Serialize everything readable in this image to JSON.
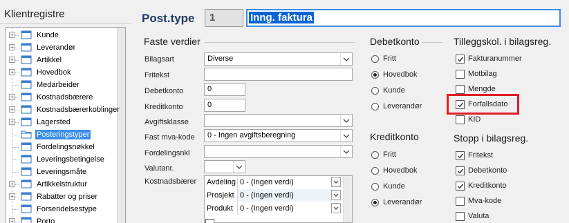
{
  "tree": {
    "title": "Klientregistre",
    "items": [
      {
        "label": "Kunde",
        "expandable": true
      },
      {
        "label": "Leverandør",
        "expandable": true
      },
      {
        "label": "Artikkel",
        "expandable": true
      },
      {
        "label": "Hovedbok",
        "expandable": true
      },
      {
        "label": "Medarbeider",
        "expandable": false
      },
      {
        "label": "Kostnadsbærere",
        "expandable": true
      },
      {
        "label": "Kostnadsbærerkoblinger",
        "expandable": true
      },
      {
        "label": "Lagersted",
        "expandable": true
      },
      {
        "label": "Posteringstyper",
        "expandable": false,
        "selected": true
      },
      {
        "label": "Fordelingsnøkkel",
        "expandable": false
      },
      {
        "label": "Leveringsbetingelse",
        "expandable": false
      },
      {
        "label": "Leveringsmåte",
        "expandable": false
      },
      {
        "label": "Artikkelstruktur",
        "expandable": true
      },
      {
        "label": "Rabatter og priser",
        "expandable": true
      },
      {
        "label": "Forsendelsestype",
        "expandable": false
      },
      {
        "label": "Porto",
        "expandable": true
      }
    ]
  },
  "header": {
    "title": "Post.type",
    "number": "1",
    "name": "Inng. faktura"
  },
  "faste": {
    "heading": "Faste verdier",
    "bilagsart_label": "Bilagsart",
    "bilagsart_value": "Diverse",
    "fritekst_label": "Fritekst",
    "fritekst_value": "",
    "debetkonto_label": "Debetkonto",
    "debetkonto_value": "0",
    "kreditkonto_label": "Kreditkonto",
    "kreditkonto_value": "0",
    "avgiftsklasse_label": "Avgiftsklasse",
    "avgiftsklasse_value": "",
    "fastmva_label": "Fast mva-kode",
    "fastmva_value": "0 - Ingen avgiftsberegning",
    "fordelingsnkl_label": "Fordelingsnkl",
    "fordelingsnkl_value": "",
    "valutanr_label": "Valutanr.",
    "valutanr_value": "",
    "kostnadsbaerer_label": "Kostnadsbærer",
    "kostnadsbaerer_rows": [
      {
        "name": "Avdeling",
        "value": "0 - (Ingen verdi)"
      },
      {
        "name": "Prosjekt",
        "value": "0 - (Ingen verdi)"
      },
      {
        "name": "Produkt",
        "value": "0 - (Ingen verdi)"
      }
    ]
  },
  "debetkonto": {
    "heading": "Debetkonto",
    "options": [
      {
        "label": "Fritt",
        "selected": false
      },
      {
        "label": "Hovedbok",
        "selected": true
      },
      {
        "label": "Kunde",
        "selected": false
      },
      {
        "label": "Leverandør",
        "selected": false
      }
    ]
  },
  "kreditkonto": {
    "heading": "Kreditkonto",
    "options": [
      {
        "label": "Fritt",
        "selected": false
      },
      {
        "label": "Hovedbok",
        "selected": false
      },
      {
        "label": "Kunde",
        "selected": false
      },
      {
        "label": "Leverandør",
        "selected": true
      }
    ]
  },
  "tilleggskol": {
    "heading": "Tilleggskol. i bilagsreg.",
    "items": [
      {
        "label": "Fakturanummer",
        "checked": true
      },
      {
        "label": "Motbilag",
        "checked": false
      },
      {
        "label": "Mengde",
        "checked": false
      },
      {
        "label": "Forfallsdato",
        "checked": true
      },
      {
        "label": "KID",
        "checked": false
      }
    ]
  },
  "stopp": {
    "heading": "Stopp i bilagsreg.",
    "items": [
      {
        "label": "Fritekst",
        "checked": true
      },
      {
        "label": "Debetkonto",
        "checked": true
      },
      {
        "label": "Kreditkonto",
        "checked": true
      },
      {
        "label": "Mva-kode",
        "checked": false
      },
      {
        "label": "Valuta",
        "checked": false
      }
    ]
  },
  "colors": {
    "accent": "#3c8ce6",
    "selection": "#0a64d6",
    "highlight_box": "#e31b23",
    "title": "#1f3864"
  }
}
